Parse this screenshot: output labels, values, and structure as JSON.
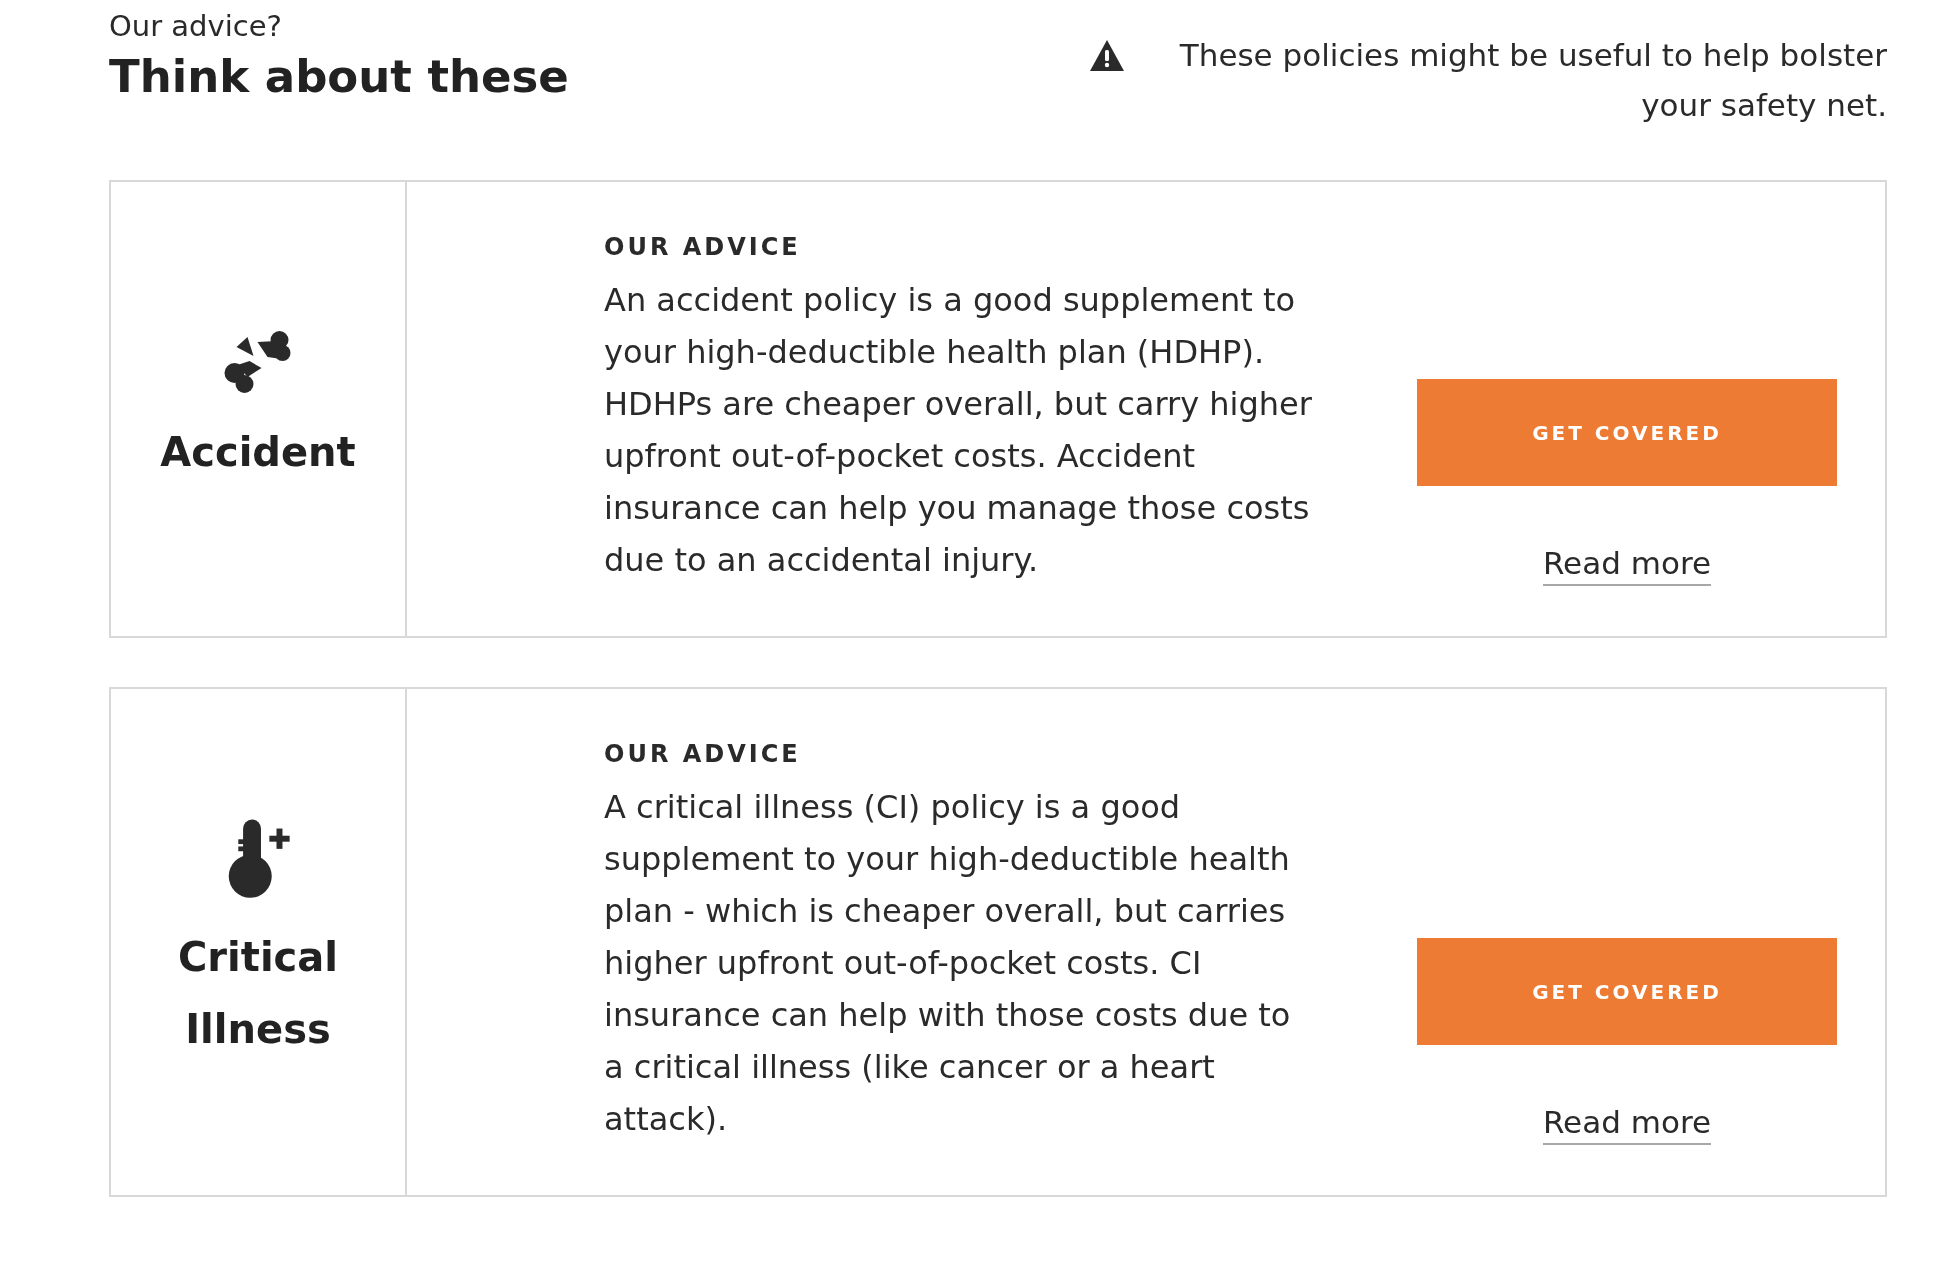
{
  "header": {
    "eyebrow": "Our advice?",
    "title": "Think about these",
    "note": "These policies might be useful to help bolster your safety net."
  },
  "policies": [
    {
      "kind": "accident",
      "name": "Accident",
      "advice_label": "OUR ADVICE",
      "advice": "An accident policy is a good supplement to your high-deductible health plan (HDHP). HDHPs are cheaper overall, but carry higher upfront out-of-pocket costs. Accident insurance can help you manage those costs due to an accidental injury.",
      "button": "GET COVERED",
      "link": "Read more"
    },
    {
      "kind": "critical_illness",
      "name": "Critical Illness",
      "advice_label": "OUR ADVICE",
      "advice": "A critical illness (CI) policy is a good supplement to your high-deductible health plan - which is cheaper overall, but carries higher upfront out-of-pocket costs. CI insurance can help with those costs due to a critical illness (like cancer or a heart attack).",
      "button": "GET COVERED",
      "link": "Read more"
    }
  ]
}
